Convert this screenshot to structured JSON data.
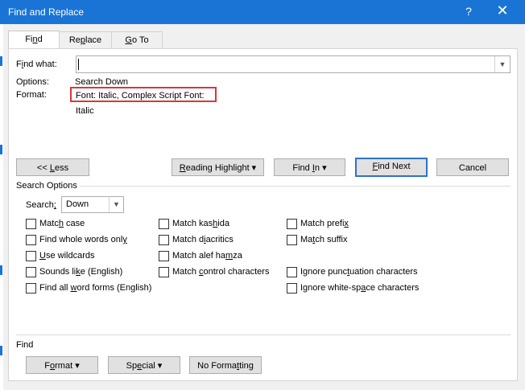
{
  "window": {
    "title": "Find and Replace",
    "help_glyph": "?",
    "close_glyph": "✕"
  },
  "tabs": [
    {
      "label_pre": "Fi",
      "label_u": "n",
      "label_post": "d"
    },
    {
      "label_pre": "Re",
      "label_u": "p",
      "label_post": "lace"
    },
    {
      "label_pre": "",
      "label_u": "G",
      "label_post": "o To"
    }
  ],
  "find": {
    "label_pre": "F",
    "label_u": "i",
    "label_post": "nd what:",
    "value": "",
    "options_label": "Options:",
    "options_value": "Search Down",
    "format_label": "Format:",
    "format_value": "Font: Italic, Complex Script Font: Italic"
  },
  "buttons": {
    "less_pre": "<< ",
    "less_u": "L",
    "less_post": "ess",
    "reading_pre": "",
    "reading_u": "R",
    "reading_post": "eading Highlight ▾",
    "findin_pre": "Find ",
    "findin_u": "I",
    "findin_post": "n ▾",
    "findnext_pre": "",
    "findnext_u": "F",
    "findnext_post": "ind Next",
    "cancel": "Cancel"
  },
  "search_options": {
    "section_label": "Search Options",
    "search_label_pre": "Search",
    "search_label_u": ";",
    "search_label_post": "",
    "search_value": "Down",
    "checkboxes": [
      {
        "pre": "Matc",
        "u": "h",
        "post": " case"
      },
      {
        "pre": "Find whole words onl",
        "u": "y",
        "post": ""
      },
      {
        "pre": "",
        "u": "U",
        "post": "se wildcards"
      },
      {
        "pre": "Sounds li",
        "u": "k",
        "post": "e (English)"
      },
      {
        "pre": "Find all ",
        "u": "w",
        "post": "ord forms (English)"
      },
      {
        "pre": "Match kas",
        "u": "h",
        "post": "ida"
      },
      {
        "pre": "Match d",
        "u": "i",
        "post": "acritics"
      },
      {
        "pre": "Match alef ha",
        "u": "m",
        "post": "za"
      },
      {
        "pre": "Match ",
        "u": "c",
        "post": "ontrol characters"
      },
      {
        "pre": "Match prefi",
        "u": "x",
        "post": ""
      },
      {
        "pre": "Ma",
        "u": "t",
        "post": "ch suffix"
      },
      {
        "pre": "Ignore punc",
        "u": "t",
        "post": "uation characters"
      },
      {
        "pre": "Ignore white-sp",
        "u": "a",
        "post": "ce characters"
      }
    ]
  },
  "footer": {
    "section_label": "Find",
    "format_pre": "F",
    "format_u": "o",
    "format_post": "rmat ▾",
    "special_pre": "Sp",
    "special_u": "e",
    "special_post": "cial ▾",
    "noformat_pre": "No Forma",
    "noformat_u": "t",
    "noformat_post": "ting"
  },
  "colors": {
    "titlebar": "#1a74d6",
    "highlight_border": "#d9363e",
    "default_button_border": "#2f73c7"
  }
}
